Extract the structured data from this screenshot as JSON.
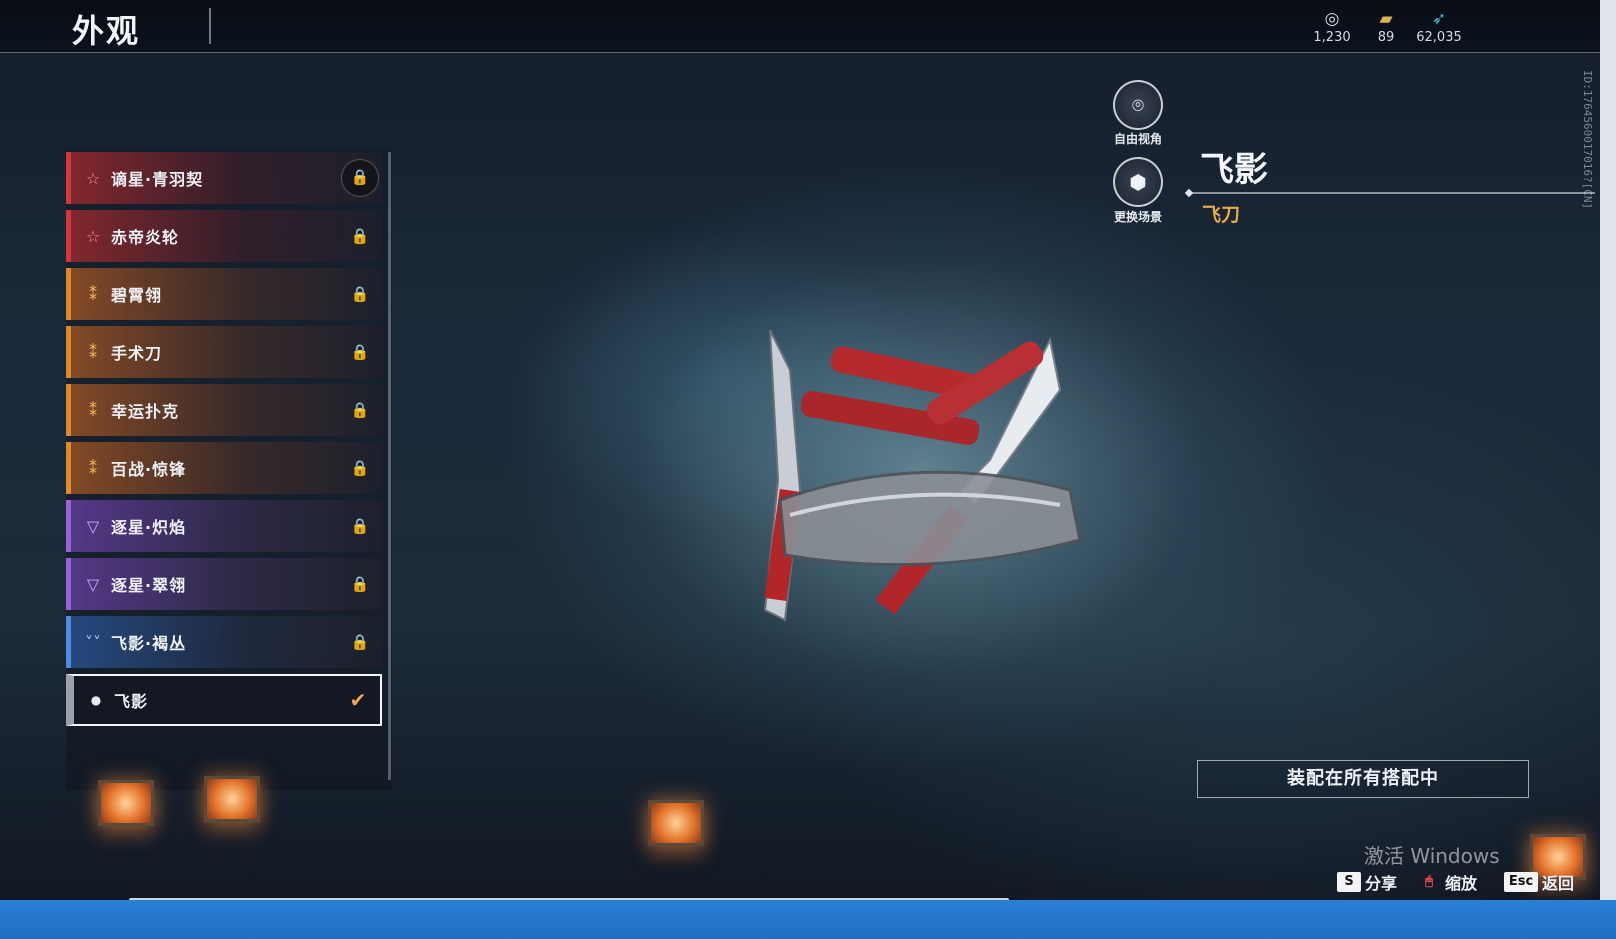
{
  "header": {
    "title": "外观"
  },
  "currency": [
    {
      "icon": "token-icon",
      "value": "1,230"
    },
    {
      "icon": "ticket-icon",
      "value": "89"
    },
    {
      "icon": "feather-icon",
      "value": "62,035"
    }
  ],
  "side_id": "ID:1764560017016?[CN]",
  "list": {
    "items": [
      {
        "name": "谪星·青羽契",
        "rarity_icon": "☆",
        "rarity": "red",
        "locked": true
      },
      {
        "name": "赤帝炎轮",
        "rarity_icon": "☆",
        "rarity": "red",
        "locked": true
      },
      {
        "name": "碧霄翎",
        "rarity_icon": "⁑",
        "rarity": "orange",
        "locked": true
      },
      {
        "name": "手术刀",
        "rarity_icon": "⁑",
        "rarity": "orange",
        "locked": true
      },
      {
        "name": "幸运扑克",
        "rarity_icon": "⁑",
        "rarity": "orange",
        "locked": true
      },
      {
        "name": "百战·惊锋",
        "rarity_icon": "⁑",
        "rarity": "orange",
        "locked": true
      },
      {
        "name": "逐星·炽焰",
        "rarity_icon": "▽",
        "rarity": "purple",
        "locked": true
      },
      {
        "name": "逐星·翠翎",
        "rarity_icon": "▽",
        "rarity": "purple",
        "locked": true
      },
      {
        "name": "飞影·褐丛",
        "rarity_icon": "˅˅",
        "rarity": "blue",
        "locked": true
      },
      {
        "name": "飞影",
        "rarity_icon": "●",
        "rarity": "white",
        "selected": true
      }
    ],
    "lock_glyph": "🔒",
    "check_glyph": "✔"
  },
  "view_controls": {
    "free_view": {
      "label": "自由视角",
      "icon": "camera-icon"
    },
    "change_scene": {
      "label": "更换场景",
      "icon": "cube-icon"
    }
  },
  "detail": {
    "title": "飞影",
    "type": "飞刀"
  },
  "equip_button": "装配在所有搭配中",
  "watermark": "激活 Windows",
  "hints": [
    {
      "key": "S",
      "label": "分享"
    },
    {
      "key": "🖱",
      "label": "缩放"
    },
    {
      "key": "Esc",
      "label": "返回"
    }
  ],
  "colors": {
    "red": "#d0383a",
    "orange": "#e08a2e",
    "purple": "#9a62d8",
    "blue": "#4d8ce0",
    "accent_type": "#e8a948",
    "check": "#f0a750"
  }
}
